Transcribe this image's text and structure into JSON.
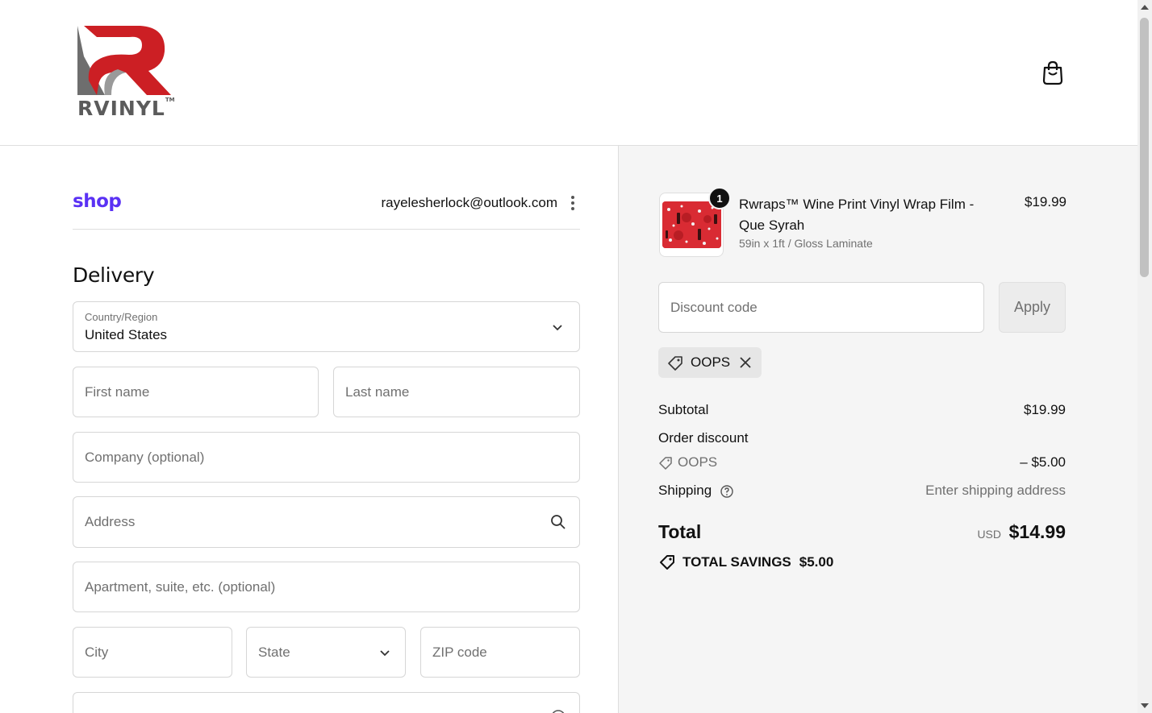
{
  "header": {
    "logo_text": "RVINYL",
    "logo_tm": "TM",
    "cart_icon": "shopping-bag-icon"
  },
  "account": {
    "shop_logo": "shop",
    "email": "rayelesherlock@outlook.com",
    "menu_icon": "kebab-menu-icon"
  },
  "delivery": {
    "title": "Delivery",
    "country_label": "Country/Region",
    "country_value": "United States",
    "first_name_placeholder": "First name",
    "last_name_placeholder": "Last name",
    "company_placeholder": "Company (optional)",
    "address_placeholder": "Address",
    "apartment_placeholder": "Apartment, suite, etc. (optional)",
    "city_placeholder": "City",
    "state_placeholder": "State",
    "zip_placeholder": "ZIP code"
  },
  "cart": {
    "product_title": "Rwraps™ Wine Print Vinyl Wrap Film - Que Syrah",
    "product_variant": "59in x 1ft / Gloss Laminate",
    "product_price": "$19.99",
    "quantity": "1"
  },
  "discount": {
    "placeholder": "Discount code",
    "apply_label": "Apply",
    "applied_code": "OOPS"
  },
  "summary": {
    "subtotal_label": "Subtotal",
    "subtotal_value": "$19.99",
    "order_discount_label": "Order discount",
    "discount_code": "OOPS",
    "discount_value": "– $5.00",
    "shipping_label": "Shipping",
    "shipping_value": "Enter shipping address",
    "total_label": "Total",
    "total_currency": "USD",
    "total_value": "$14.99",
    "savings_label": "TOTAL SAVINGS",
    "savings_value": "$5.00"
  },
  "colors": {
    "shop_purple": "#5a31f4",
    "logo_red": "#cc1f24",
    "logo_gray": "#5b5b5b",
    "summary_bg": "#f5f5f5"
  }
}
